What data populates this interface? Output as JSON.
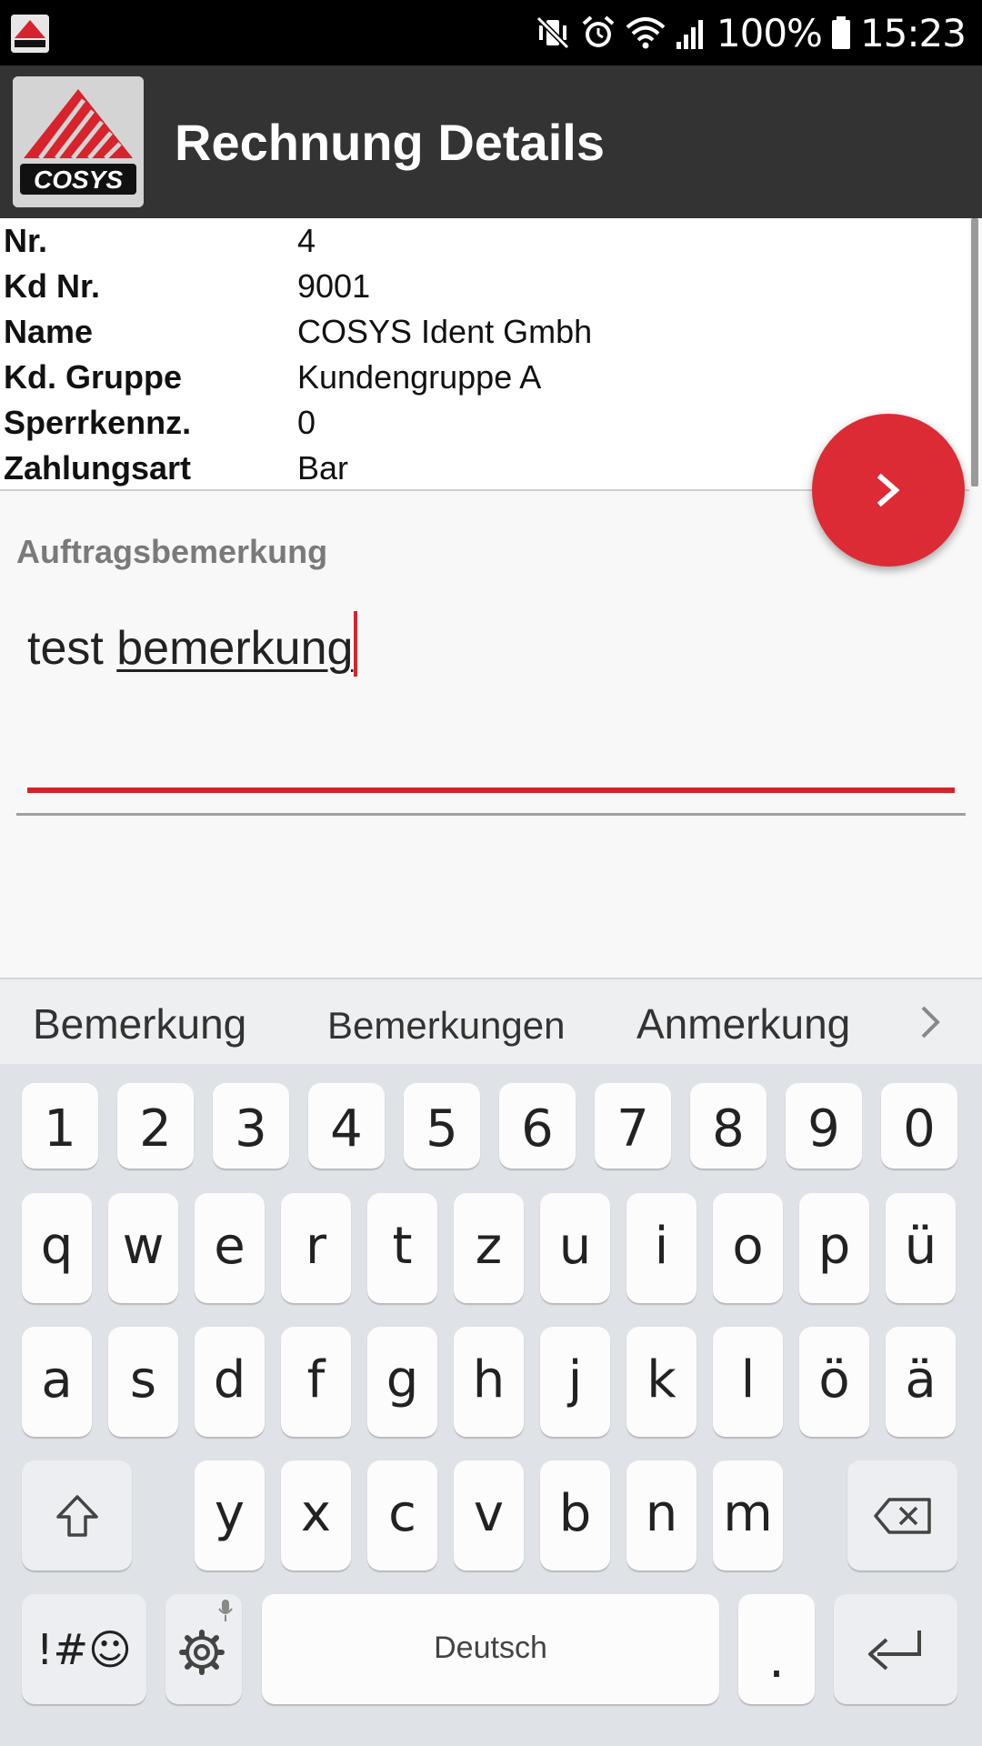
{
  "status_bar": {
    "battery_text": "100%",
    "time": "15:23",
    "icons": [
      "app-logo-icon",
      "vibrate-mute-icon",
      "alarm-icon",
      "wifi-icon",
      "signal-icon",
      "battery-icon"
    ]
  },
  "app_bar": {
    "logo_text": "COSYS",
    "title": "Rechnung Details"
  },
  "details": [
    {
      "label": "Nr.",
      "value": "4"
    },
    {
      "label": "Kd Nr.",
      "value": "9001"
    },
    {
      "label": "Name",
      "value": "COSYS Ident Gmbh"
    },
    {
      "label": "Kd. Gruppe",
      "value": "Kundengruppe A"
    },
    {
      "label": "Sperrkennz.",
      "value": "0"
    },
    {
      "label": "Zahlungsart",
      "value": "Bar"
    }
  ],
  "fab": {
    "icon": "chevron-right-icon",
    "color": "#dc2b35"
  },
  "remark": {
    "label": "Auftragsbemerkung",
    "value_word1": "test ",
    "value_word2": "bemerkung",
    "accent": "#d2222c"
  },
  "keyboard": {
    "suggestions": [
      "Bemerkung",
      "Bemerkungen",
      "Anmerkung"
    ],
    "number_row": [
      "1",
      "2",
      "3",
      "4",
      "5",
      "6",
      "7",
      "8",
      "9",
      "0"
    ],
    "row1": [
      "q",
      "w",
      "e",
      "r",
      "t",
      "z",
      "u",
      "i",
      "o",
      "p",
      "ü"
    ],
    "row2": [
      "a",
      "s",
      "d",
      "f",
      "g",
      "h",
      "j",
      "k",
      "l",
      "ö",
      "ä"
    ],
    "row3": [
      "y",
      "x",
      "c",
      "v",
      "b",
      "n",
      "m"
    ],
    "symbols_label": "!#☺",
    "space_label": "Deutsch",
    "period_label": "."
  }
}
